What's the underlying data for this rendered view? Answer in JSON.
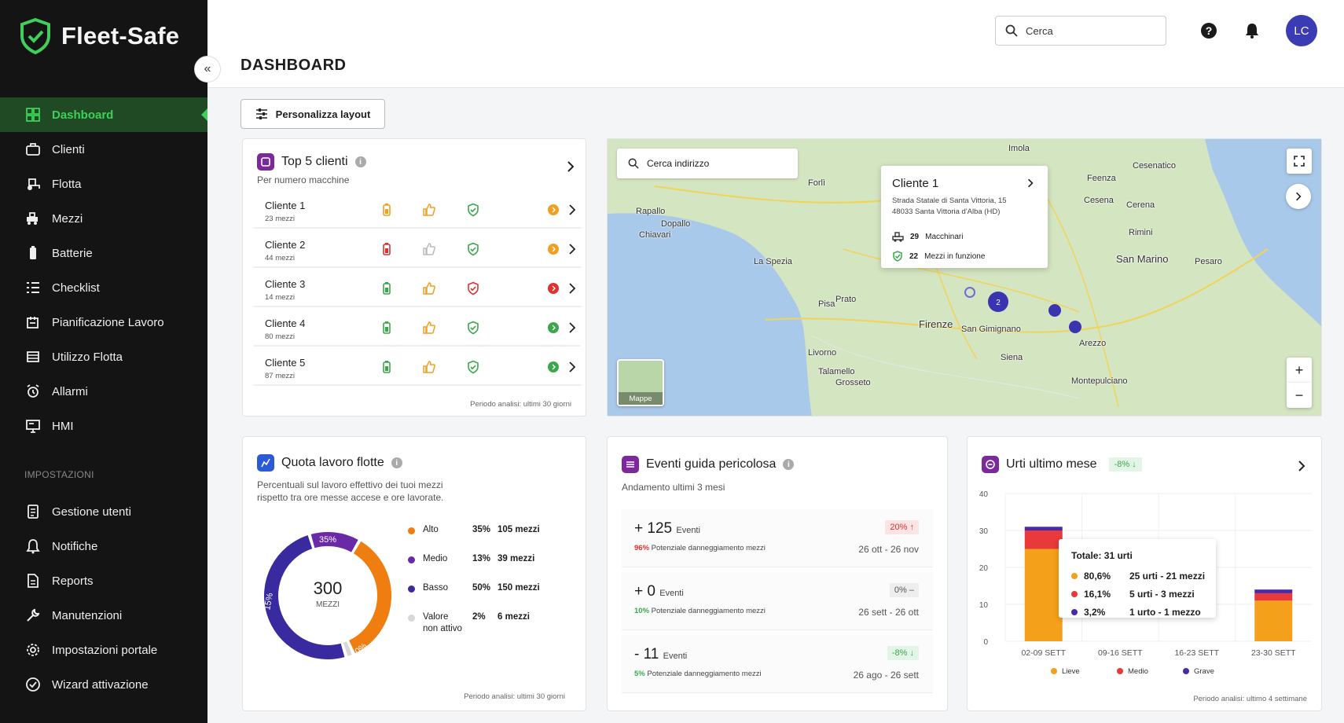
{
  "app": {
    "name": "Fleet-Safe"
  },
  "sidebar": {
    "items": [
      {
        "label": "Dashboard",
        "icon": "grid-icon"
      },
      {
        "label": "Clienti",
        "icon": "briefcase-icon"
      },
      {
        "label": "Flotta",
        "icon": "fleet-icon"
      },
      {
        "label": "Mezzi",
        "icon": "vehicle-icon"
      },
      {
        "label": "Batterie",
        "icon": "battery-icon"
      },
      {
        "label": "Checklist",
        "icon": "checklist-icon"
      },
      {
        "label": "Pianificazione Lavoro",
        "icon": "planning-icon"
      },
      {
        "label": "Utilizzo Flotta",
        "icon": "usage-icon"
      },
      {
        "label": "Allarmi",
        "icon": "alarm-icon"
      },
      {
        "label": "HMI",
        "icon": "hmi-icon"
      }
    ],
    "section_label": "IMPOSTAZIONI",
    "settings": [
      {
        "label": "Gestione utenti",
        "icon": "users-icon"
      },
      {
        "label": "Notifiche",
        "icon": "bell-icon"
      },
      {
        "label": "Reports",
        "icon": "report-icon"
      },
      {
        "label": "Manutenzioni",
        "icon": "wrench-icon"
      },
      {
        "label": "Impostazioni portale",
        "icon": "gear-icon"
      },
      {
        "label": "Wizard attivazione",
        "icon": "check-circle-icon"
      }
    ]
  },
  "header": {
    "title": "DASHBOARD",
    "search_placeholder": "Cerca",
    "avatar": "LC"
  },
  "toolbar": {
    "customize_label": "Personalizza layout"
  },
  "top_clients": {
    "title": "Top 5 clienti",
    "subtitle": "Per numero macchine",
    "footer": "Periodo analisi: ultimi 30 giorni",
    "rows": [
      {
        "name": "Cliente 1",
        "count": "23 mezzi",
        "battery": "#f0a020",
        "thumb": "#f0a020",
        "shield": "#3aa84a",
        "status": "#f0a020"
      },
      {
        "name": "Cliente 2",
        "count": "44 mezzi",
        "battery": "#e03030",
        "thumb": "#bbbbbb",
        "shield": "#3aa84a",
        "status": "#f0a020"
      },
      {
        "name": "Cliente 3",
        "count": "14 mezzi",
        "battery": "#3aa84a",
        "thumb": "#f0a020",
        "shield": "#e03030",
        "status": "#e03030"
      },
      {
        "name": "Cliente 4",
        "count": "80 mezzi",
        "battery": "#3aa84a",
        "thumb": "#f0a020",
        "shield": "#3aa84a",
        "status": "#3aa84a"
      },
      {
        "name": "Cliente 5",
        "count": "87 mezzi",
        "battery": "#3aa84a",
        "thumb": "#f0a020",
        "shield": "#3aa84a",
        "status": "#3aa84a"
      }
    ]
  },
  "map": {
    "search_placeholder": "Cerca indirizzo",
    "popup": {
      "title": "Cliente 1",
      "address_line1": "Strada Statale di Santa Vittoria, 15",
      "address_line2": "48033 Santa Vittoria d'Alba (HD)",
      "machines_value": "29",
      "machines_label": "Macchinari",
      "vehicles_value": "22",
      "vehicles_label": "Mezzi in funzione"
    },
    "cluster_label": "2",
    "layer_label": "Mappe",
    "places": [
      "Imola",
      "Forlì",
      "Cesenatico",
      "Feenza",
      "Cesena",
      "Cerena",
      "Rimini",
      "San Marino",
      "Pesaro",
      "Rapallo",
      "Dopallo",
      "Chiavari",
      "La Spezia",
      "Pisa",
      "Prato",
      "Firenze",
      "San Gimignano",
      "Arezzo",
      "Livorno",
      "Siena",
      "Montepulciano",
      "Grosseto",
      "Talamello"
    ]
  },
  "work_share": {
    "title": "Quota lavoro flotte",
    "subtitle_line1": "Percentuali sul lavoro effettivo dei tuoi mezzi",
    "subtitle_line2": "rispetto tra ore messe accese e ore lavorate.",
    "total_value": "300",
    "total_label": "MEZZI",
    "footer": "Periodo analisi: ultimi 30 giorni",
    "legend": [
      {
        "label": "Alto",
        "label2": "",
        "percent": "35%",
        "count": "105 mezzi",
        "color": "#f07d0f"
      },
      {
        "label": "Medio",
        "label2": "",
        "percent": "13%",
        "count": "39 mezzi",
        "color": "#6a2aa8"
      },
      {
        "label": "Basso",
        "label2": "",
        "percent": "50%",
        "count": "150 mezzi",
        "color": "#3a2aa0"
      },
      {
        "label": "Valore",
        "label2": "non attivo",
        "percent": "2%",
        "count": "6 mezzi",
        "color": "#d8d8d8"
      }
    ],
    "ring_labels": {
      "a": "35%",
      "b": "15%",
      "c": "50%"
    }
  },
  "events": {
    "title": "Eventi guida pericolosa",
    "subtitle": "Andamento ultimi 3 mesi",
    "rows": [
      {
        "value": "+ 125",
        "unit": "Eventi",
        "pct": "96%",
        "pct_label": "Potenziale danneggiamento mezzi",
        "pct_color": "#e03030",
        "badge": "20% ↑",
        "badge_bg": "#fde4e4",
        "badge_color": "#e03030",
        "range": "26 ott - 26 nov"
      },
      {
        "value": "+ 0",
        "unit": "Eventi",
        "pct": "10%",
        "pct_label": "Potenziale danneggiamento mezzi",
        "pct_color": "#3aa84a",
        "badge": "0% –",
        "badge_bg": "#eeeeee",
        "badge_color": "#555555",
        "range": "26 sett - 26 ott"
      },
      {
        "value": "- 11",
        "unit": "Eventi",
        "pct": "5%",
        "pct_label": "Potenziale danneggiamento mezzi",
        "pct_color": "#3aa84a",
        "badge": "-8% ↓",
        "badge_bg": "#e3f5e6",
        "badge_color": "#3aa84a",
        "range": "26 ago - 26 sett"
      }
    ]
  },
  "impacts": {
    "title": "Urti ultimo mese",
    "badge": "-8% ↓",
    "footer": "Periodo analisi: ultimo 4 settimane",
    "tooltip": {
      "title": "Totale: 31 urti",
      "rows": [
        {
          "pct": "80,6%",
          "text": "25 urti - 21 mezzi",
          "color": "#f5a01a"
        },
        {
          "pct": "16,1%",
          "text": "5 urti - 3 mezzi",
          "color": "#e83a3a"
        },
        {
          "pct": "3,2%",
          "text": "1 urto - 1 mezzo",
          "color": "#4a2aa8"
        }
      ]
    }
  },
  "chart_data": {
    "type": "bar",
    "categories": [
      "02-09 SETT",
      "09-16 SETT",
      "16-23 SETT",
      "23-30 SETT"
    ],
    "series": [
      {
        "name": "Lieve",
        "values": [
          25,
          0,
          0,
          11
        ],
        "color": "#f5a01a"
      },
      {
        "name": "Medio",
        "values": [
          5,
          0,
          0,
          2
        ],
        "color": "#e83a3a"
      },
      {
        "name": "Grave",
        "values": [
          1,
          0,
          0,
          1
        ],
        "color": "#4a2aa8"
      }
    ],
    "ylim": [
      0,
      40
    ],
    "yticks": [
      "0",
      "10",
      "20",
      "30",
      "40"
    ],
    "grid": true,
    "legend": "bottom"
  }
}
